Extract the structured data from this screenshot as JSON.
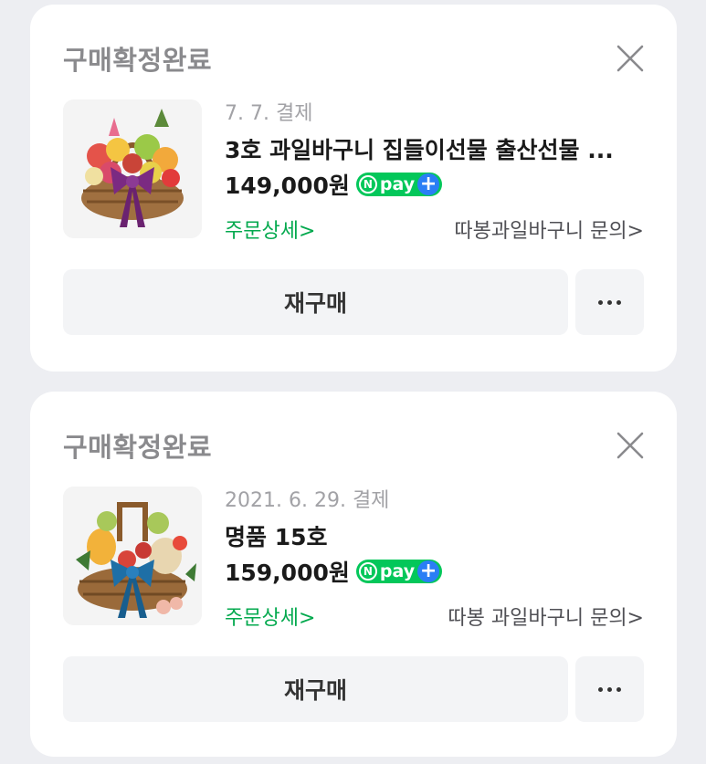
{
  "orders": [
    {
      "status": "구매확정완료",
      "date": "7. 7. 결제",
      "title": "3호 과일바구니 집들이선물 출산선물 ...",
      "price": "149,000원",
      "npay_text": "pay",
      "detail_link": "주문상세>",
      "inquiry_link": "따봉과일바구니 문의>",
      "rebuy_label": "재구매",
      "ribbon_color": "#7b2a82"
    },
    {
      "status": "구매확정완료",
      "date": "2021. 6. 29. 결제",
      "title": "명품 15호",
      "price": "159,000원",
      "npay_text": "pay",
      "detail_link": "주문상세>",
      "inquiry_link": "따봉 과일바구니 문의>",
      "rebuy_label": "재구매",
      "ribbon_color": "#1e6fa6"
    }
  ],
  "colors": {
    "background": "#edeef2",
    "card": "#ffffff",
    "npay_green": "#03c75a",
    "npay_plus_blue": "#2a7ef5",
    "detail_link_green": "#03a94e"
  },
  "icons": {
    "close": "close-icon",
    "more": "more-dots-icon",
    "npay_logo": "npay-logo"
  }
}
